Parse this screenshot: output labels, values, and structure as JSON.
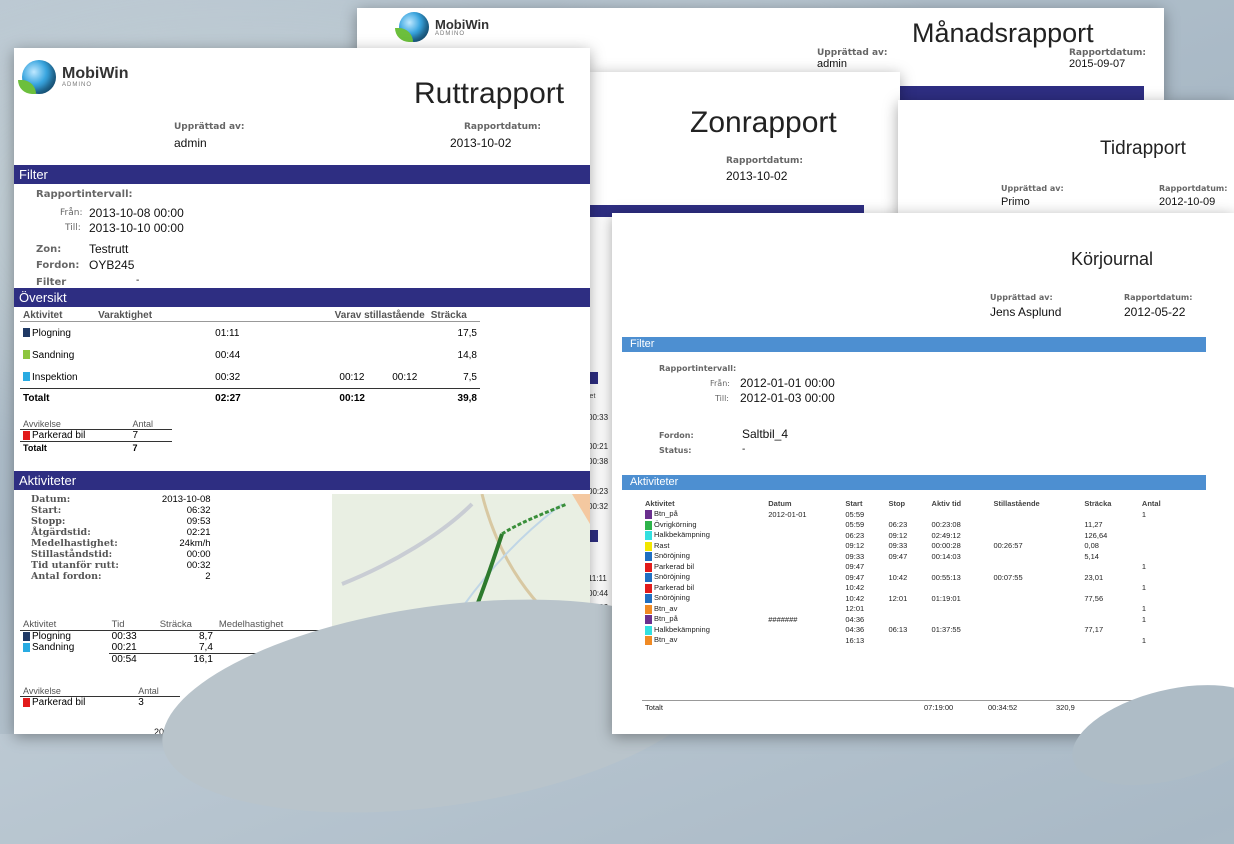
{
  "monthly": {
    "logo": "MobiWin",
    "logo_sub": "ADMINO",
    "title": "Månadsrapport",
    "created_label": "Upprättad av:",
    "created": "admin",
    "date_label": "Rapportdatum:",
    "date": "2015-09-07"
  },
  "zone": {
    "title": "Zonrapport",
    "date_label": "Rapportdatum:",
    "date": "2013-10-02",
    "side_header": "iet",
    "side_vals": [
      "00:33",
      "00:21",
      "00:38",
      "00:23",
      "00:32",
      "11:11",
      "00:44",
      "00:32",
      "02:27"
    ]
  },
  "time": {
    "title": "Tidrapport",
    "created_label": "Upprättad av:",
    "created": "Primo",
    "date_label": "Rapportdatum:",
    "date": "2012-10-09"
  },
  "route": {
    "logo": "MobiWin",
    "logo_sub": "ADMINO",
    "title": "Ruttrapport",
    "created_label": "Upprättad av:",
    "created": "admin",
    "date_label": "Rapportdatum:",
    "date": "2013-10-02",
    "filter_header": "Filter",
    "interval_label": "Rapportintervall:",
    "from_label": "Från:",
    "from": "2013-10-08 00:00",
    "to_label": "Till:",
    "to": "2013-10-10 00:00",
    "zone_label": "Zon:",
    "zone": "Testrutt",
    "vehicle_label": "Fordon:",
    "vehicle": "OYB245",
    "filter_label": "Filter",
    "filter_val": "-",
    "overview_header": "Översikt",
    "overview_cols": [
      "Aktivitet",
      "Varaktighet",
      "Varav stillastående",
      "Sträcka"
    ],
    "overview_rows": [
      {
        "c": "#1f3864",
        "a": "Plogning",
        "d": "01:11",
        "s1": "",
        "s2": "",
        "km": "17,5"
      },
      {
        "c": "#8dc63f",
        "a": "Sandning",
        "d": "00:44",
        "s1": "",
        "s2": "",
        "km": "14,8"
      },
      {
        "c": "#29abe2",
        "a": "Inspektion",
        "d": "00:32",
        "s1": "00:12",
        "s2": "00:12",
        "km": "7,5"
      }
    ],
    "overview_total": {
      "a": "Totalt",
      "d": "02:27",
      "s1": "00:12",
      "km": "39,8"
    },
    "dev_cols": [
      "Avvikelse",
      "Antal"
    ],
    "dev_rows": [
      {
        "c": "#e21b1b",
        "a": "Parkerad bil",
        "n": "7"
      }
    ],
    "dev_total": {
      "a": "Totalt",
      "n": "7"
    },
    "activities_header": "Aktiviteter",
    "details": [
      [
        "Datum:",
        "2013-10-08"
      ],
      [
        "Start:",
        "06:32"
      ],
      [
        "Stopp:",
        "09:53"
      ],
      [
        "Åtgärdstid:",
        "02:21"
      ],
      [
        "Medelhastighet:",
        "24km/h"
      ],
      [
        "Stillaståndstid:",
        "00:00"
      ],
      [
        "Tid utanför rutt:",
        "00:32"
      ],
      [
        "Antal fordon:",
        "2"
      ]
    ],
    "act_cols": [
      "Aktivitet",
      "Tid",
      "Sträcka",
      "Medelhastighet"
    ],
    "act_rows": [
      {
        "c": "#1f3864",
        "a": "Plogning",
        "t": "00:33",
        "km": "8,7",
        "v": "22"
      },
      {
        "c": "#29abe2",
        "a": "Sandning",
        "t": "00:21",
        "km": "7,4",
        "v": "26"
      }
    ],
    "act_total": {
      "t": "00:54",
      "km": "16,1",
      "v": "24"
    },
    "dev2_cols": [
      "Avvikelse",
      "Antal"
    ],
    "dev2_rows": [
      {
        "c": "#e21b1b",
        "a": "Parkerad bil",
        "n": "3"
      }
    ],
    "bottom_date": "2013-10-0"
  },
  "journal": {
    "title": "Körjournal",
    "created_label": "Upprättad av:",
    "created": "Jens Asplund",
    "date_label": "Rapportdatum:",
    "date": "2012-05-22",
    "filter_header": "Filter",
    "interval_label": "Rapportintervall:",
    "from_label": "Från:",
    "from": "2012-01-01 00:00",
    "to_label": "Till:",
    "to": "2012-01-03 00:00",
    "vehicle_label": "Fordon:",
    "vehicle": "Saltbil_4",
    "status_label": "Status:",
    "status": "-",
    "activities_header": "Aktiviteter",
    "cols": [
      "Aktivitet",
      "Datum",
      "Start",
      "Stop",
      "Aktiv tid",
      "Stillastående",
      "Sträcka",
      "Antal"
    ],
    "rows": [
      {
        "c": "#6a2f8e",
        "a": "Btn_på",
        "d": "2012-01-01",
        "s": "05:59",
        "e": "",
        "t": "",
        "st": "",
        "km": "",
        "n": "1"
      },
      {
        "c": "#2eb34a",
        "a": "Övrigkörning",
        "d": "",
        "s": "05:59",
        "e": "06:23",
        "t": "00:23:08",
        "st": "",
        "km": "11,27",
        "n": ""
      },
      {
        "c": "#33e0e0",
        "a": "Halkbekämpning",
        "d": "",
        "s": "06:23",
        "e": "09:12",
        "t": "02:49:12",
        "st": "",
        "km": "126,64",
        "n": ""
      },
      {
        "c": "#f2e600",
        "a": "Rast",
        "d": "",
        "s": "09:12",
        "e": "09:33",
        "t": "00:00:28",
        "st": "00:26:57",
        "km": "0,08",
        "n": ""
      },
      {
        "c": "#1f6fc2",
        "a": "Snöröjning",
        "d": "",
        "s": "09:33",
        "e": "09:47",
        "t": "00:14:03",
        "st": "",
        "km": "5,14",
        "n": ""
      },
      {
        "c": "#e21b1b",
        "a": "Parkerad bil",
        "d": "",
        "s": "09:47",
        "e": "",
        "t": "",
        "st": "",
        "km": "",
        "n": "1"
      },
      {
        "c": "#1f6fc2",
        "a": "Snöröjning",
        "d": "",
        "s": "09:47",
        "e": "10:42",
        "t": "00:55:13",
        "st": "00:07:55",
        "km": "23,01",
        "n": ""
      },
      {
        "c": "#e21b1b",
        "a": "Parkerad bil",
        "d": "",
        "s": "10:42",
        "e": "",
        "t": "",
        "st": "",
        "km": "",
        "n": "1"
      },
      {
        "c": "#1f6fc2",
        "a": "Snöröjning",
        "d": "",
        "s": "10:42",
        "e": "12:01",
        "t": "01:19:01",
        "st": "",
        "km": "77,56",
        "n": ""
      },
      {
        "c": "#f08a24",
        "a": "Btn_av",
        "d": "",
        "s": "12:01",
        "e": "",
        "t": "",
        "st": "",
        "km": "",
        "n": "1"
      },
      {
        "c": "#6a2f8e",
        "a": "Btn_på",
        "d": "#######",
        "s": "04:36",
        "e": "",
        "t": "",
        "st": "",
        "km": "",
        "n": "1"
      },
      {
        "c": "#33e0e0",
        "a": "Halkbekämpning",
        "d": "",
        "s": "04:36",
        "e": "06:13",
        "t": "01:37:55",
        "st": "",
        "km": "77,17",
        "n": ""
      },
      {
        "c": "#f08a24",
        "a": "Btn_av",
        "d": "",
        "s": "16:13",
        "e": "",
        "t": "",
        "st": "",
        "km": "",
        "n": "1"
      }
    ],
    "total": {
      "a": "Totalt",
      "t": "07:19:00",
      "st": "00:34:52",
      "km": "320,9",
      "n": "6"
    }
  }
}
